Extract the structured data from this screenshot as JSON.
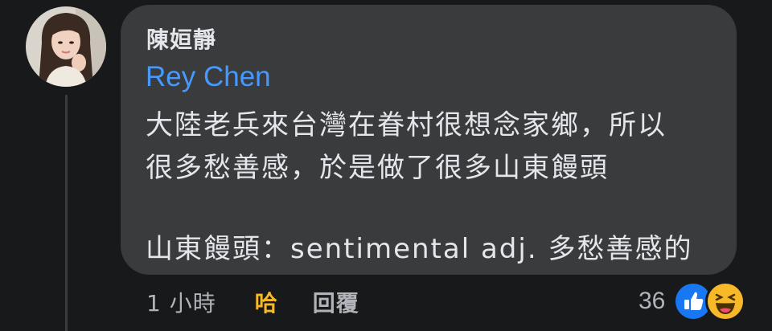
{
  "comment": {
    "author": "陳姮靜",
    "mention": "Rey Chen",
    "body": [
      "大陸老兵來台灣在眷村很想念家鄉，所以",
      "很多愁善感，於是做了很多山東饅頭",
      "山東饅頭：sentimental adj. 多愁善感的"
    ]
  },
  "actions": {
    "time": "1 小時",
    "reaction": "哈",
    "reply": "回覆"
  },
  "reactions": {
    "count": "36",
    "icons": [
      "like-icon",
      "haha-icon"
    ]
  },
  "colors": {
    "background": "#18191a",
    "bubble": "#3a3b3c",
    "mention": "#4599ff",
    "reaction_active": "#f7b928",
    "like_blue": "#1877f2",
    "haha_yellow": "#f7b928"
  }
}
